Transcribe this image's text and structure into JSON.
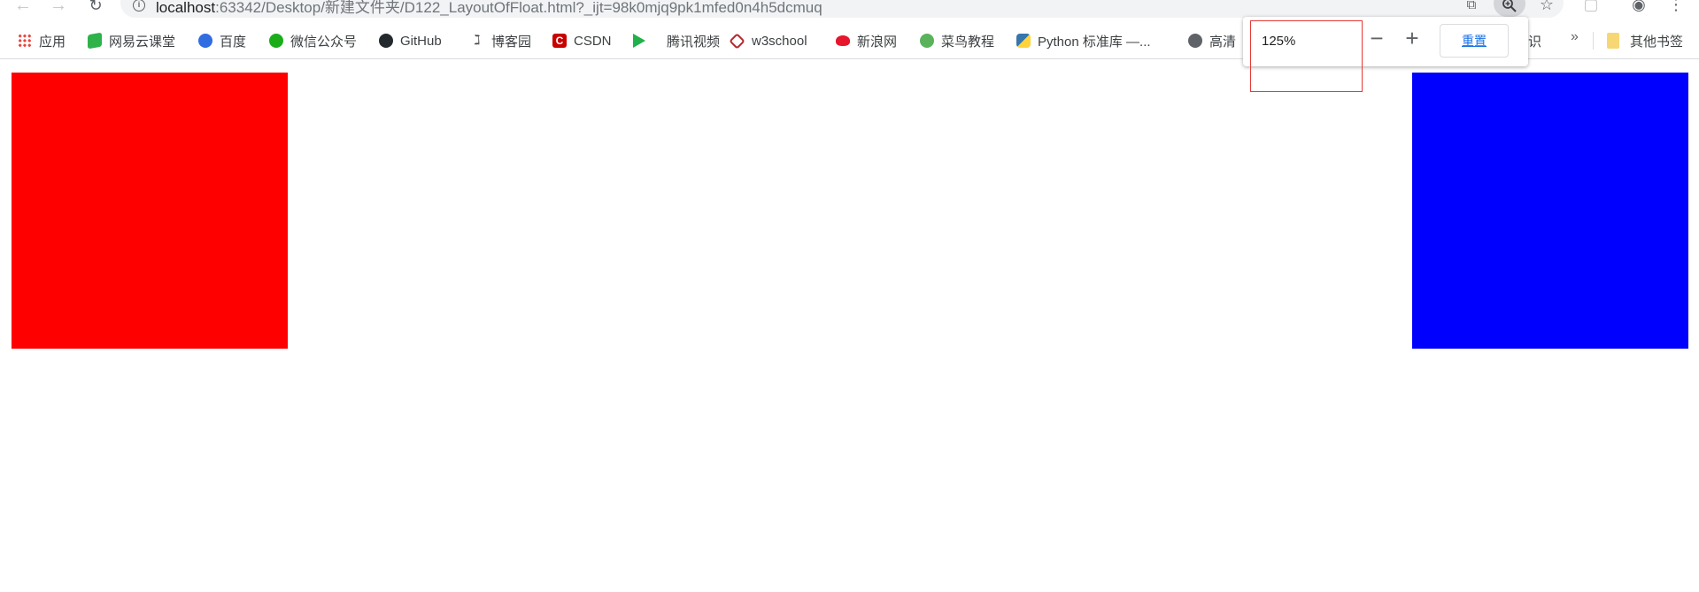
{
  "address_bar": {
    "host": "localhost",
    "path": ":63342/Desktop/新建文件夹/D122_LayoutOfFloat.html?_ijt=98k0mjq9pk1mfed0n4h5dcmuq"
  },
  "bookmarks": [
    {
      "label": "应用",
      "icon": "apps-grid-icon",
      "color": "#e8453c"
    },
    {
      "label": "网易云课堂",
      "icon": "netease-study-icon",
      "color": "#2eb24a"
    },
    {
      "label": "百度",
      "icon": "baidu-paw-icon",
      "color": "#2f6de0"
    },
    {
      "label": "微信公众号",
      "icon": "wechat-icon",
      "color": "#1aad19"
    },
    {
      "label": "GitHub",
      "icon": "github-icon",
      "color": "#24292e"
    },
    {
      "label": "博客园",
      "icon": "cnblogs-icon",
      "color": "#444444"
    },
    {
      "label": "CSDN",
      "icon": "csdn-icon",
      "color": "#c90000"
    },
    {
      "label": "腾讯视频",
      "icon": "tencent-video-icon",
      "color": "#20b14a"
    },
    {
      "label": "w3school",
      "icon": "w3school-icon",
      "color": "#b5282e"
    },
    {
      "label": "新浪网",
      "icon": "sina-icon",
      "color": "#e6162d"
    },
    {
      "label": "菜鸟教程",
      "icon": "runoob-icon",
      "color": "#5ab25a"
    },
    {
      "label": "Python 标准库 —...",
      "icon": "python-icon",
      "color": "#3776ab"
    },
    {
      "label": "高清",
      "icon": "globe-icon",
      "color": "#5f6368"
    },
    {
      "label": "识",
      "icon": "",
      "color": ""
    },
    {
      "label": "其他书签",
      "icon": "folder-icon",
      "color": "#f7d774"
    }
  ],
  "zoom_popup": {
    "level": "125%",
    "minus_label": "−",
    "plus_label": "+",
    "reset_label": "重置"
  },
  "page_boxes": {
    "left_color": "#ff0000",
    "right_color": "#0000ff"
  }
}
